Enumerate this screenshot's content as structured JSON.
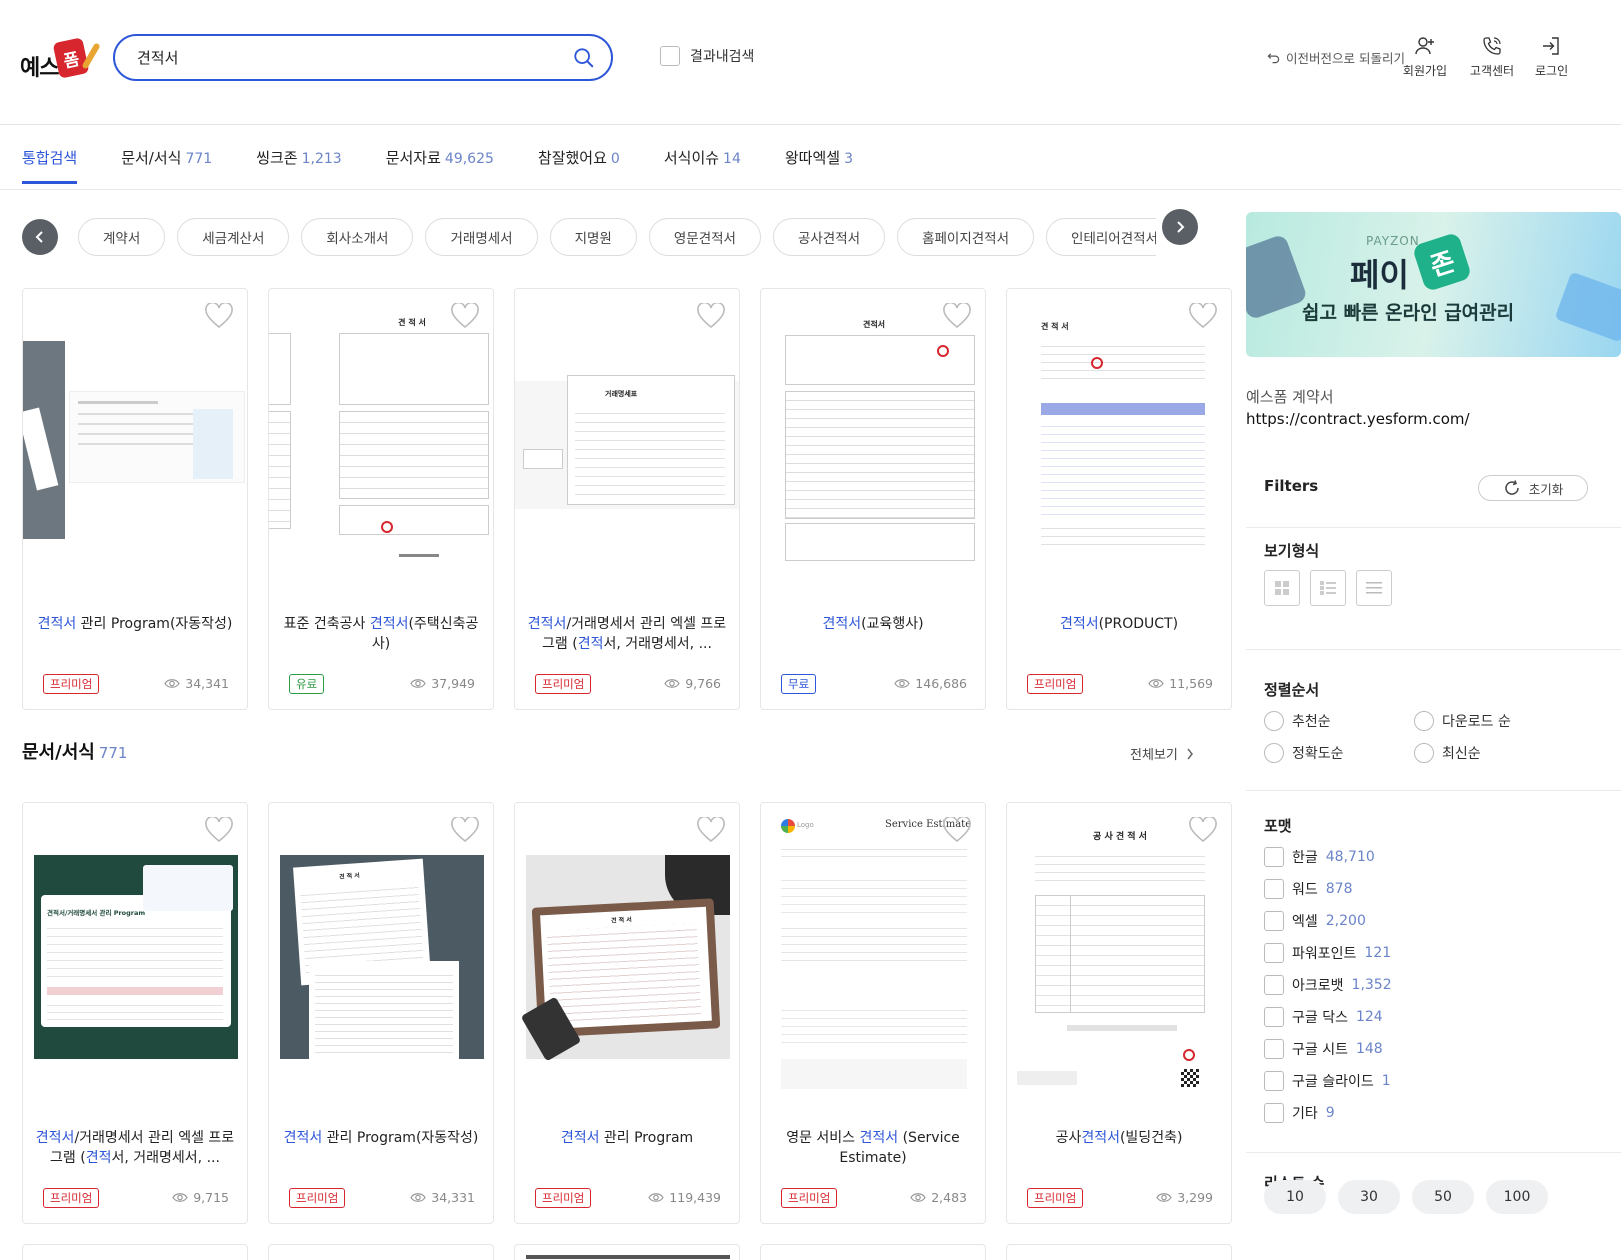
{
  "header": {
    "logo_text": "예스폼",
    "logo_badge": "폼",
    "search_value": "견적서",
    "in_result_label": "결과내검색",
    "prev_version": "이전버전으로 되돌리기",
    "signup": "회원가입",
    "support": "고객센터",
    "login": "로그인"
  },
  "tabs": [
    {
      "label": "통합검색",
      "count": ""
    },
    {
      "label": "문서/서식",
      "count": "771"
    },
    {
      "label": "씽크존",
      "count": "1,213"
    },
    {
      "label": "문서자료",
      "count": "49,625"
    },
    {
      "label": "참잘했어요",
      "count": "0"
    },
    {
      "label": "서식이슈",
      "count": "14"
    },
    {
      "label": "왕따엑셀",
      "count": "3"
    }
  ],
  "chips": [
    "계약서",
    "세금계산서",
    "회사소개서",
    "거래명세서",
    "지명원",
    "영문견적서",
    "공사견적서",
    "홈페이지견적서",
    "인테리어견적서",
    "…"
  ],
  "cards_row1": [
    {
      "title_hl": "견적서",
      "title_rest": " 관리 Program(자동작성)",
      "badge": "프리미엄",
      "views": "34,341"
    },
    {
      "title_pre": "표준 건축공사 ",
      "title_hl": "견적서",
      "title_rest": "(주택신축공사)",
      "badge": "유료",
      "views": "37,949"
    },
    {
      "title_hl": "견적서",
      "title_rest": "/거래명세서 관리 엑셀 프로그램 (",
      "title_hl2": "견적",
      "title_rest2": "서, 거래명세서, ...",
      "badge": "프리미엄",
      "views": "9,766"
    },
    {
      "title_hl": "견적서",
      "title_rest": "(교육행사)",
      "badge": "무료",
      "views": "146,686"
    },
    {
      "title_hl": "견적서",
      "title_rest": "(PRODUCT)",
      "badge": "프리미엄",
      "views": "11,569"
    }
  ],
  "section": {
    "title": "문서/서식",
    "count": "771",
    "see_all": "전체보기"
  },
  "cards_row2": [
    {
      "title_hl": "견적서",
      "title_rest": "/거래명세서 관리 엑셀 프로그램 (",
      "title_hl2": "견적",
      "title_rest2": "서, 거래명세서, ...",
      "badge": "프리미엄",
      "views": "9,715"
    },
    {
      "title_hl": "견적서",
      "title_rest": " 관리 Program(자동작성)",
      "badge": "프리미엄",
      "views": "34,331"
    },
    {
      "title_hl": "견적서",
      "title_rest": " 관리 Program",
      "badge": "프리미엄",
      "views": "119,439"
    },
    {
      "title_pre": "영문 서비스 ",
      "title_hl": "견적서",
      "title_rest": " (Service Estimate)",
      "badge": "프리미엄",
      "views": "2,483"
    },
    {
      "title_pre": "공사",
      "title_hl": "견적서",
      "title_rest": "(빌딩건축)",
      "badge": "프리미엄",
      "views": "3,299"
    }
  ],
  "thumb_text": {
    "doc2_title": "견 적 서",
    "doc3_title": "거래명세표",
    "doc4_title": "견적서",
    "doc5_title": "견 적 서",
    "g1_title": "견적서/거래명세서 관리 Program",
    "g2_title": "견 적 서",
    "g3_title": "견 적 서",
    "se_title": "Service Estimate",
    "se_logo": "Logo",
    "bid_title": "공 사 견 적 서"
  },
  "sidebar": {
    "banner_payzon": "PAYZON",
    "banner_pay": "페이",
    "banner_zon": "존",
    "banner_sub": "쉽고 빠른 온라인 급여관리",
    "ad_text": "예스폼 계약서",
    "ad_url": "https://contract.yesform.com/",
    "filters": "Filters",
    "reset": "초기화",
    "view_type": "보기형식",
    "sort": "정렬순서",
    "sort_options": [
      "추천순",
      "다운로드 순",
      "정확도순",
      "최신순"
    ],
    "format": "포맷",
    "formats": [
      {
        "label": "한글",
        "count": "48,710"
      },
      {
        "label": "워드",
        "count": "878"
      },
      {
        "label": "엑셀",
        "count": "2,200"
      },
      {
        "label": "파워포인트",
        "count": "121"
      },
      {
        "label": "아크로뱃",
        "count": "1,352"
      },
      {
        "label": "구글 닥스",
        "count": "124"
      },
      {
        "label": "구글 시트",
        "count": "148"
      },
      {
        "label": "구글 슬라이드",
        "count": "1"
      },
      {
        "label": "기타",
        "count": "9"
      }
    ],
    "list_count": "리스트 수",
    "list_counts": [
      "10",
      "30",
      "50",
      "100"
    ]
  },
  "colors": {
    "accent": "#2d56d8",
    "premium": "#d7262e",
    "paid": "#2f9b43"
  }
}
